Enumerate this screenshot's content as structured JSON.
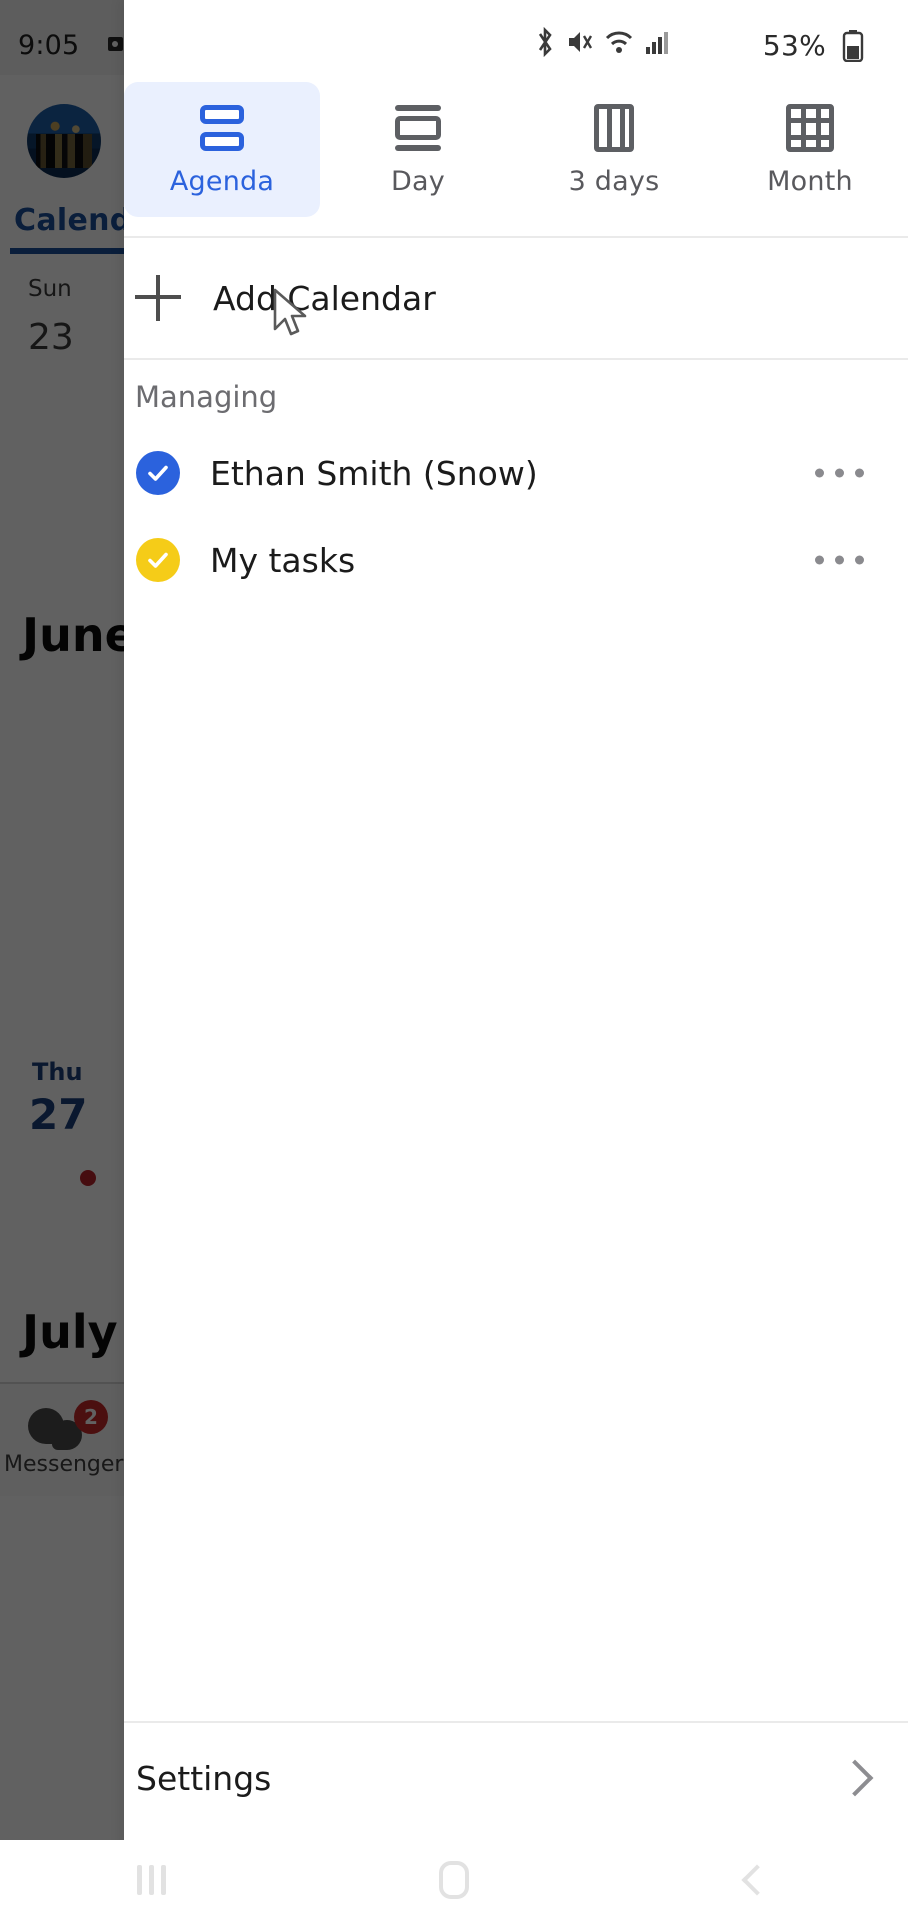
{
  "status_bar": {
    "time": "9:05",
    "battery_percent": "53%",
    "icons": [
      "video-camera-icon",
      "bluetooth-icon",
      "mute-icon",
      "wifi-icon",
      "signal-icon",
      "battery-icon"
    ]
  },
  "view_tabs": [
    {
      "label": "Agenda",
      "icon": "agenda-view-icon",
      "active": true
    },
    {
      "label": "Day",
      "icon": "day-view-icon",
      "active": false
    },
    {
      "label": "3 days",
      "icon": "three-days-view-icon",
      "active": false
    },
    {
      "label": "Month",
      "icon": "month-view-icon",
      "active": false
    }
  ],
  "add_calendar": {
    "label": "Add Calendar",
    "icon": "plus-icon"
  },
  "managing": {
    "section_title": "Managing",
    "calendars": [
      {
        "name": "Ethan Smith (Snow)",
        "checked": true,
        "color": "#2b62dd",
        "menu": "overflow-menu-icon"
      },
      {
        "name": "My tasks",
        "checked": true,
        "color": "#f5cc18",
        "menu": "overflow-menu-icon"
      }
    ]
  },
  "settings": {
    "label": "Settings",
    "chevron": "chevron-right-icon"
  },
  "background_calendar": {
    "time": "9:05",
    "tab_title": "Calendar",
    "day_label": "Sun",
    "day_number": "23",
    "month_june": "June",
    "second_day_label": "Thu",
    "second_day_number": "27",
    "month_july": "July",
    "messenger_label": "Messenger",
    "messenger_badge": "2"
  },
  "nav_bar": {
    "recents": "recents-icon",
    "home": "home-icon",
    "back": "back-icon"
  },
  "colors": {
    "accent": "#2b62dd",
    "tab_active_bg": "#eaf0fe",
    "task_yellow": "#f5cc18",
    "badge_red": "#c62828"
  }
}
